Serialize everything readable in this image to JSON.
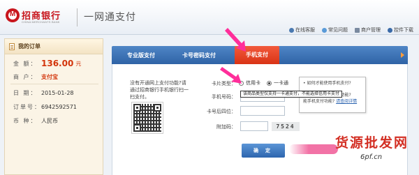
{
  "header": {
    "bank_name": "招商银行",
    "bank_name_en": "CHINA MERCHANTS BANK",
    "product_name": "一网通支付",
    "links": [
      "在线客服",
      "常见问题",
      "商户管理",
      "控件下载"
    ]
  },
  "order": {
    "title": "我的订单",
    "amount_label": "金 额：",
    "amount_value": "136.00",
    "amount_unit": "元",
    "merchant_label": "商 户：",
    "merchant_value": "支付宝",
    "date_label": "日 期：",
    "date_value": "2015-01-28",
    "order_no_label": "订单号：",
    "order_no_value": "6942592571",
    "currency_label": "币 种：",
    "currency_value": "人民币"
  },
  "tabs": [
    "专业版支付",
    "卡号密码支付",
    "手机支付"
  ],
  "qr": {
    "note": "没有开通网上支付功能?请通过招商银行手机银行扫一扫支付。"
  },
  "form": {
    "card_type_label": "卡片类型：",
    "card_type_options": [
      "信用卡",
      "一卡通"
    ],
    "card_type_selected": "一卡通",
    "phone_label": "手机号码：",
    "card_last4_label": "卡号后四位：",
    "extra_code_label": "附加码：",
    "captcha_text": "7524",
    "submit_label": "确 定"
  },
  "tooltip_text": "该商品类型仅支持一卡通支付，不能选择信用卡支付",
  "help_box": {
    "line1": "• 如何才能使用手机支付?",
    "line2": "• 如何开通手机支付功能?",
    "line3": "能手机支付功能?",
    "link_text": "请查阅详情"
  },
  "watermark": {
    "text": "货源批发网",
    "url": "6pf.cn"
  },
  "colors": {
    "brand_red": "#c8161d",
    "tab_blue": "#2f63a6",
    "tab_active": "#e0401f",
    "amount": "#d3350c",
    "arrow": "#ff2e9a"
  }
}
